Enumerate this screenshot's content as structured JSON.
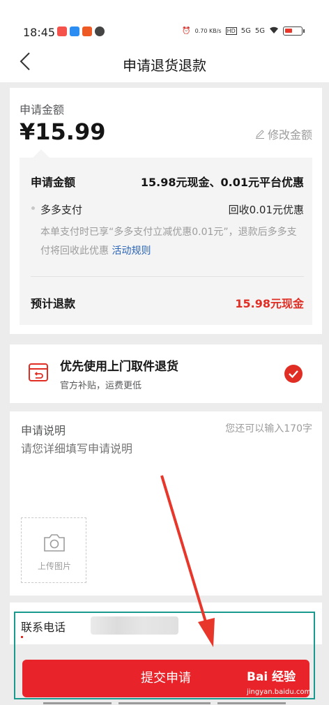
{
  "status_bar": {
    "time": "18:45",
    "net_speed": "0.70 KB/s",
    "signal1": "5G",
    "signal2": "5G",
    "hd": "HD",
    "icons": [
      "alarm-icon",
      "wifi-icon",
      "battery-icon"
    ]
  },
  "nav": {
    "title": "申请退货退款",
    "back_icon": "chevron-left-icon"
  },
  "amount": {
    "label": "申请金额",
    "value": "¥15.99",
    "edit_label": "修改金额"
  },
  "breakdown": {
    "label": "申请金额",
    "value": "15.98元现金、0.01元平台优惠",
    "pay_label": "多多支付",
    "pay_value": "回收0.01元优惠",
    "note": "本单支付时已享“多多支付立减优惠0.01元”，退款后多多支付将回收此优惠",
    "rule_link": "活动规则",
    "estimate_label": "预计退款",
    "estimate_value": "15.98元现金"
  },
  "pickup": {
    "title": "优先使用上门取件退货",
    "subtitle": "官方补贴，运费更低",
    "checked": true
  },
  "description": {
    "label": "申请说明",
    "remaining": "您还可以输入170字",
    "placeholder": "请您详细填写申请说明",
    "upload_label": "上传图片"
  },
  "contact": {
    "label": "联系电话"
  },
  "submit": {
    "label": "提交申请"
  },
  "watermark": {
    "brand": "Bai 经验",
    "url": "jingyan.baidu.com"
  },
  "colors": {
    "accent": "#e02e24",
    "link": "#2a64b8",
    "highlight": "#1a9a8e"
  }
}
